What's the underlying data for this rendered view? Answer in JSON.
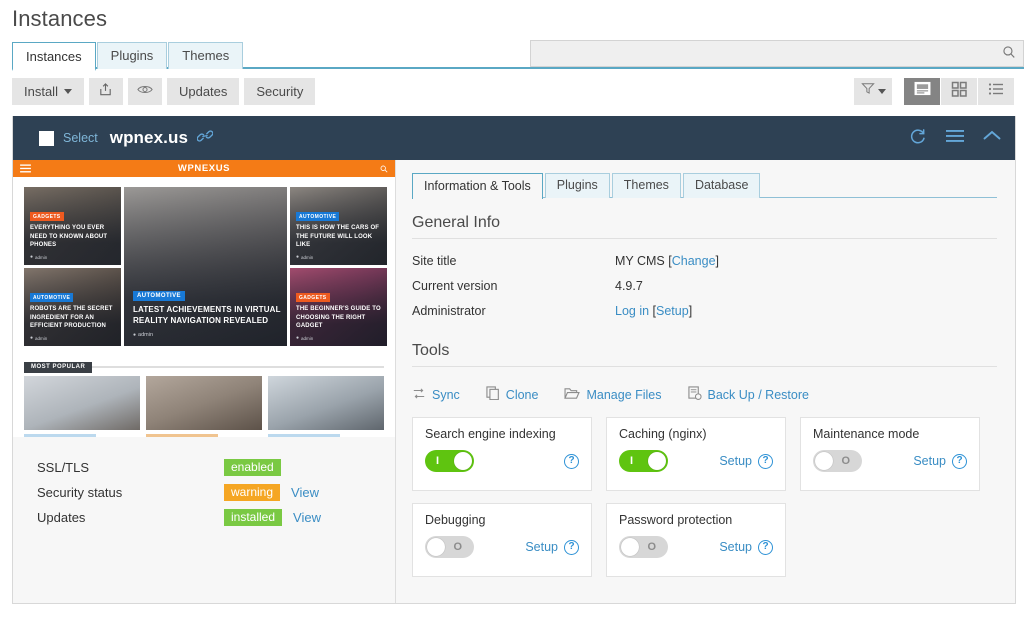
{
  "page": {
    "title": "Instances"
  },
  "tabs": [
    {
      "label": "Instances",
      "active": true
    },
    {
      "label": "Plugins",
      "active": false
    },
    {
      "label": "Themes",
      "active": false
    }
  ],
  "search": {
    "value": "",
    "placeholder": "",
    "icon": "search-icon"
  },
  "toolbar": {
    "install_label": "Install",
    "import_icon": "upload-box-icon",
    "preview_icon": "eye-icon",
    "updates_label": "Updates",
    "security_label": "Security",
    "filter_icon": "filter-funnel-icon",
    "views": [
      {
        "name": "card-view",
        "icon": "card-view-icon",
        "active": true
      },
      {
        "name": "grid-view",
        "icon": "grid-view-icon",
        "active": false
      },
      {
        "name": "list-view",
        "icon": "list-view-icon",
        "active": false
      }
    ]
  },
  "instance": {
    "select_label": "Select",
    "domain": "wpnex.us",
    "link_icon": "chain-link-icon",
    "header_color": "#2e4154",
    "actions": [
      {
        "name": "refresh-icon",
        "label": "refresh"
      },
      {
        "name": "menu-icon",
        "label": "menu"
      },
      {
        "name": "collapse-icon",
        "label": "collapse"
      }
    ]
  },
  "preview": {
    "brand": "WPNEXUS",
    "brand_color": "#f47b16",
    "menu_icon": "hamburger-icon",
    "search_icon": "search-icon",
    "articles": [
      {
        "category": "GADGETS",
        "cat_class": "cat-gadgets",
        "title": "EVERYTHING YOU EVER NEED TO KNOWN ABOUT PHONES",
        "author": "admin"
      },
      {
        "category": "AUTOMOTIVE",
        "cat_class": "cat-auto",
        "title": "ROBOTS ARE THE SECRET INGREDIENT FOR AN EFFICIENT PRODUCTION",
        "author": "admin"
      },
      {
        "category": "AUTOMOTIVE",
        "cat_class": "cat-auto",
        "title": "LATEST ACHIEVEMENTS IN VIRTUAL REALITY NAVIGATION REVEALED",
        "author": "admin"
      },
      {
        "category": "AUTOMOTIVE",
        "cat_class": "cat-auto",
        "title": "THIS IS HOW THE CARS OF THE FUTURE WILL LOOK LIKE",
        "author": "admin"
      },
      {
        "category": "GADGETS",
        "cat_class": "cat-gadgets",
        "title": "THE BEGINNER'S GUIDE TO CHOOSING THE RIGHT GADGET",
        "author": "admin"
      }
    ],
    "most_popular_label": "MOST POPULAR"
  },
  "status_rows": [
    {
      "label": "SSL/TLS",
      "badge": "enabled",
      "badge_color": "#7ac943",
      "badge_class": "green",
      "link": ""
    },
    {
      "label": "Security status",
      "badge": "warning",
      "badge_color": "#f5a623",
      "badge_class": "orange",
      "link": "View"
    },
    {
      "label": "Updates",
      "badge": "installed",
      "badge_color": "#7ac943",
      "badge_class": "green",
      "link": "View"
    }
  ],
  "subtabs": [
    {
      "label": "Information & Tools",
      "active": true
    },
    {
      "label": "Plugins",
      "active": false
    },
    {
      "label": "Themes",
      "active": false
    },
    {
      "label": "Database",
      "active": false
    }
  ],
  "general_info": {
    "title": "General Info",
    "rows": [
      {
        "key": "Site title",
        "value": "MY CMS ",
        "link": "Change",
        "bracket": true,
        "prefix": "",
        "suffix": ""
      },
      {
        "key": "Current version",
        "value": "4.9.7",
        "link": "",
        "bracket": false
      },
      {
        "key": "Administrator",
        "value": "",
        "link": "Log in",
        "link2": "Setup",
        "bracket": true
      }
    ]
  },
  "tools": {
    "title": "Tools",
    "links": [
      {
        "label": "Sync",
        "icon": "sync-icon"
      },
      {
        "label": "Clone",
        "icon": "clone-icon"
      },
      {
        "label": "Manage Files",
        "icon": "folder-open-icon"
      },
      {
        "label": "Back Up / Restore",
        "icon": "backup-icon"
      }
    ]
  },
  "tiles": [
    {
      "label": "Search engine indexing",
      "state": "on",
      "mark": "I",
      "setup": "",
      "help": "?"
    },
    {
      "label": "Caching (nginx)",
      "state": "on",
      "mark": "I",
      "setup": "Setup",
      "help": "?"
    },
    {
      "label": "Maintenance mode",
      "state": "off",
      "mark": "O",
      "setup": "Setup",
      "help": "?"
    },
    {
      "label": "Debugging",
      "state": "off",
      "mark": "O",
      "setup": "Setup",
      "help": "?"
    },
    {
      "label": "Password protection",
      "state": "off",
      "mark": "O",
      "setup": "Setup",
      "help": "?"
    }
  ]
}
